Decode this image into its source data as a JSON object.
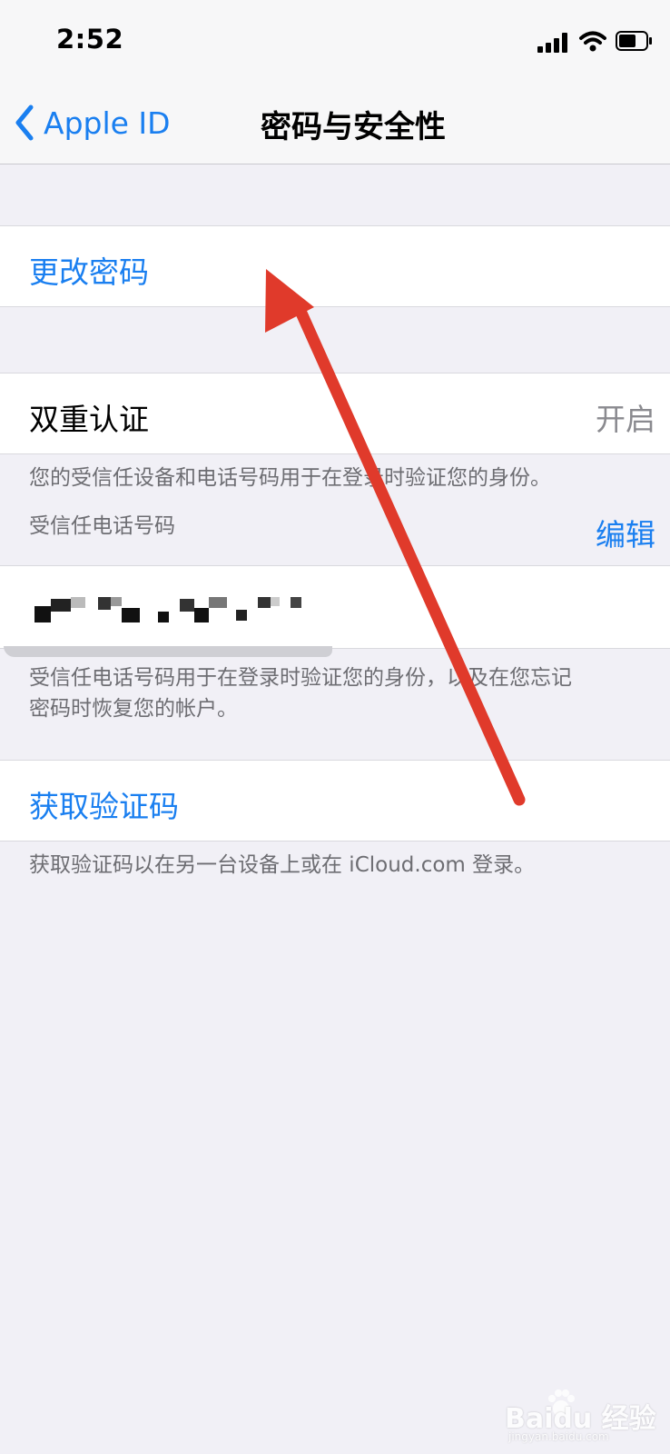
{
  "status": {
    "time": "2:52"
  },
  "nav": {
    "back_label": "Apple ID",
    "title": "密码与安全性"
  },
  "change_password": {
    "label": "更改密码"
  },
  "two_factor": {
    "label": "双重认证",
    "value": "开启",
    "footer": "您的受信任设备和电话号码用于在登录时验证您的身份。"
  },
  "trusted_phone": {
    "header": "受信任电话号码",
    "edit_label": "编辑",
    "footer_line1": "受信任电话号码用于在登录时验证您的身份，以及在您忘记",
    "footer_line2": "密码时恢复您的帐户。"
  },
  "verification_code": {
    "label": "获取验证码",
    "footer": "获取验证码以在另一台设备上或在 iCloud.com 登录。"
  },
  "watermark": {
    "text": "Baidu 经验",
    "subtext": "jingyan.baidu.com"
  },
  "colors": {
    "accent": "#1a7ff0",
    "background": "#f1f0f6",
    "arrow": "#e03a2b"
  }
}
